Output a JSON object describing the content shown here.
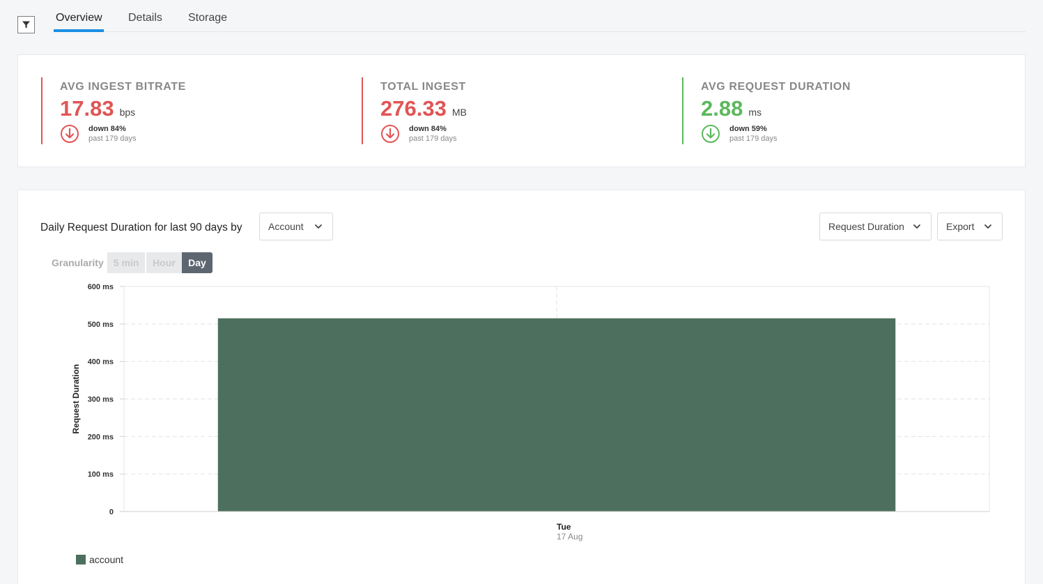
{
  "toolbar": {
    "filter_icon": "filter-icon"
  },
  "tabs": [
    {
      "label": "Overview",
      "active": true
    },
    {
      "label": "Details",
      "active": false
    },
    {
      "label": "Storage",
      "active": false
    }
  ],
  "kpis": [
    {
      "title": "AVG INGEST BITRATE",
      "value": "17.83",
      "unit": "bps",
      "change": "down 84%",
      "period": "past 179 days",
      "status": "bad",
      "icon": "arrow-down-circle-icon"
    },
    {
      "title": "TOTAL INGEST",
      "value": "276.33",
      "unit": "MB",
      "change": "down 84%",
      "period": "past 179 days",
      "status": "bad",
      "icon": "arrow-down-circle-icon"
    },
    {
      "title": "AVG REQUEST DURATION",
      "value": "2.88",
      "unit": "ms",
      "change": "down 59%",
      "period": "past 179 days",
      "status": "good",
      "icon": "arrow-down-circle-icon"
    }
  ],
  "chart_panel": {
    "title": "Daily Request Duration for last 90 days by",
    "group_by": "Account",
    "metric": "Request Duration",
    "export_label": "Export",
    "granularity_label": "Granularity",
    "granularity_options": [
      {
        "label": "5 min",
        "enabled": false,
        "active": false
      },
      {
        "label": "Hour",
        "enabled": false,
        "active": false
      },
      {
        "label": "Day",
        "enabled": true,
        "active": true
      }
    ]
  },
  "colors": {
    "bad": "#e05555",
    "good": "#5cb85c",
    "accent": "#1a8fe3",
    "series": "#4d6f5e"
  },
  "chart_data": {
    "type": "bar",
    "categories": [
      "Tue 17 Aug"
    ],
    "category_labels": [
      {
        "day": "Tue",
        "date": "17 Aug"
      }
    ],
    "series": [
      {
        "name": "account",
        "values": [
          515
        ],
        "color": "#4d6f5e"
      }
    ],
    "ylabel": "Request Duration",
    "ylim": [
      0,
      600
    ],
    "yticks": [
      0,
      100,
      200,
      300,
      400,
      500,
      600
    ],
    "ytick_labels": [
      "0",
      "100 ms",
      "200 ms",
      "300 ms",
      "400 ms",
      "500 ms",
      "600 ms"
    ],
    "grid": true,
    "legend": "bottom-left"
  }
}
